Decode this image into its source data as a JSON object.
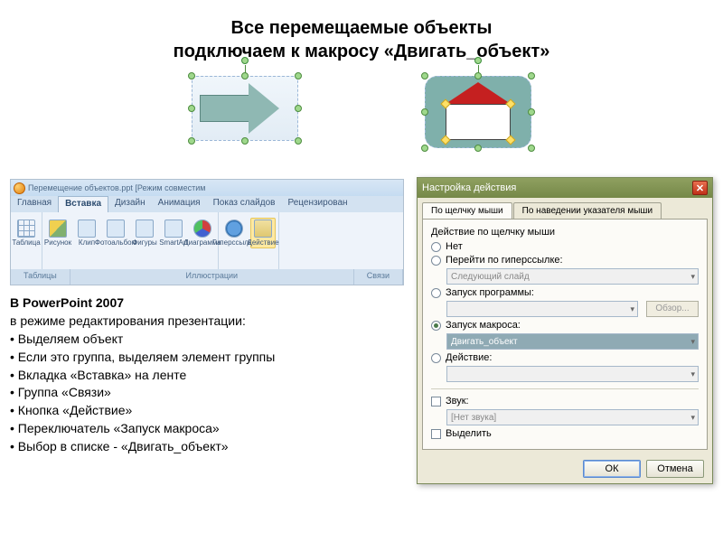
{
  "title_line1": "Все перемещаемые объекты",
  "title_line2": "подключаем к макросу «Двигать_объект»",
  "ribbon": {
    "window_title": "Перемещение объектов.ppt [Режим совместим",
    "tabs": [
      "Главная",
      "Вставка",
      "Дизайн",
      "Анимация",
      "Показ слайдов",
      "Рецензирован"
    ],
    "active_tab": "Вставка",
    "group_tables": "Таблица",
    "section_tables": "Таблицы",
    "group_illustrations_items": [
      "Рисунок",
      "Клип",
      "Фотоальбом",
      "Фигуры",
      "SmartArt",
      "Диаграмма"
    ],
    "section_illustrations": "Иллюстрации",
    "group_links_items": [
      "Гиперссылка",
      "Действие"
    ],
    "section_links": "Связи"
  },
  "instructions": {
    "heading": "В PowerPoint 2007",
    "intro": "в режиме редактирования презентации:",
    "bullets": [
      "• Выделяем объект",
      "• Если это группа, выделяем элемент группы",
      "• Вкладка «Вставка» на ленте",
      "• Группа «Связи»",
      "• Кнопка «Действие»",
      "• Переключатель «Запуск макроса»",
      "• Выбор в списке - «Двигать_объект»"
    ]
  },
  "dialog": {
    "title": "Настройка действия",
    "tab1": "По щелчку мыши",
    "tab2": "По наведении указателя мыши",
    "group_label": "Действие по щелчку мыши",
    "opt_none": "Нет",
    "opt_hyperlink": "Перейти по гиперссылке:",
    "hyperlink_value": "Следующий слайд",
    "opt_program": "Запуск программы:",
    "browse": "Обзор...",
    "opt_macro": "Запуск макроса:",
    "macro_value": "Двигать_объект",
    "opt_ole": "Действие:",
    "chk_sound": "Звук:",
    "sound_value": "[Нет звука]",
    "chk_highlight": "Выделить",
    "ok": "ОК",
    "cancel": "Отмена"
  }
}
